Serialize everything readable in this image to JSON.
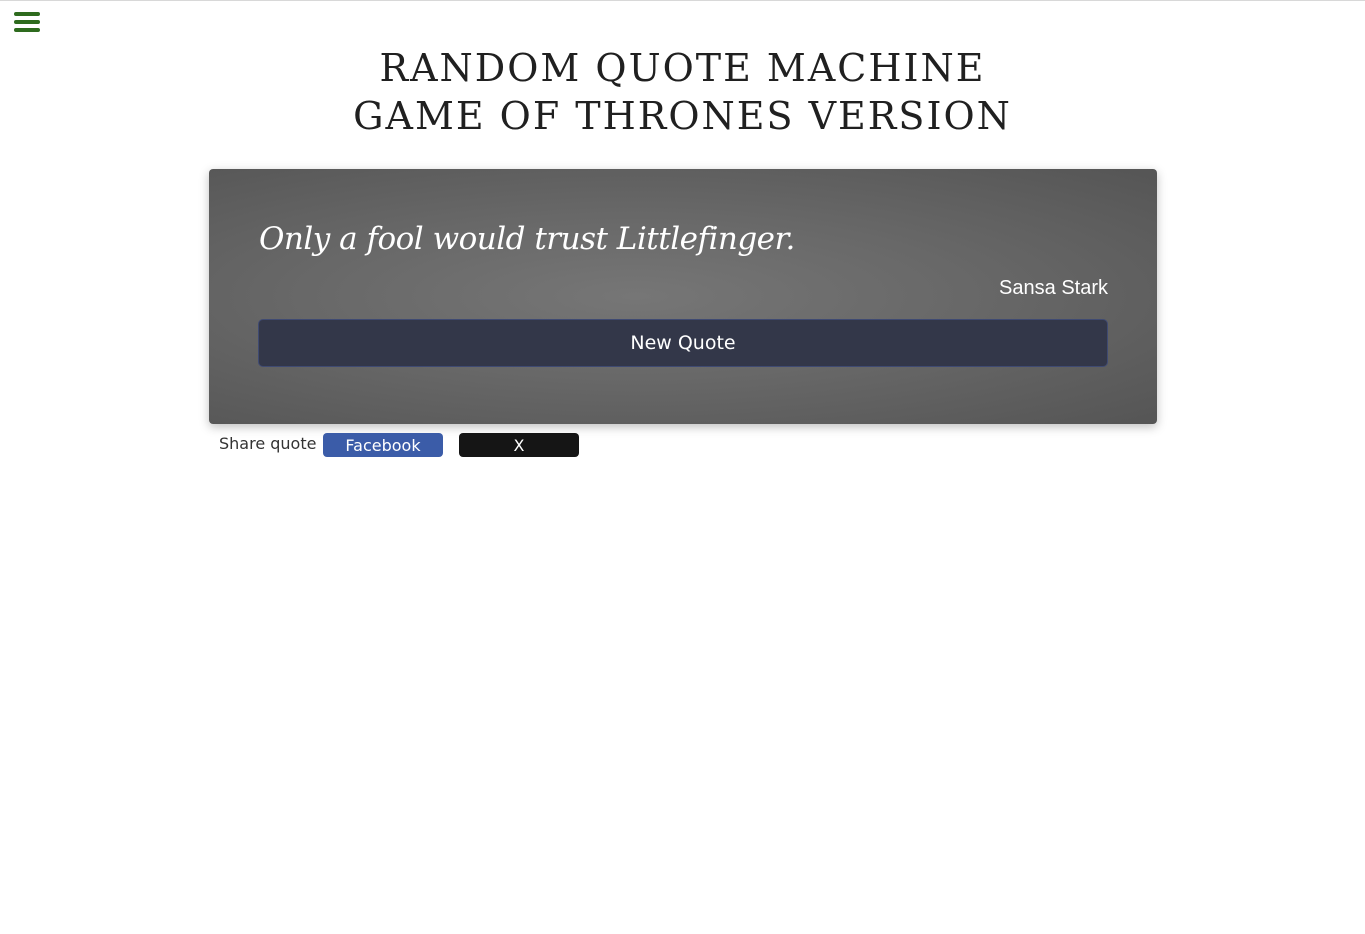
{
  "header": {
    "menu_icon": "hamburger-menu-icon",
    "menu_color": "#2e6b1e",
    "title_line1": "RANDOM QUOTE MACHINE",
    "title_line2": "GAME OF THRONES VERSION"
  },
  "quote": {
    "text": "Only a fool would trust Littlefinger.",
    "author": "Sansa Stark",
    "new_quote_label": "New Quote",
    "button_color": "#333749"
  },
  "share": {
    "label": "Share quote",
    "facebook_label": "Facebook",
    "facebook_color": "#3b5ca8",
    "x_label": "X",
    "x_color": "#151515"
  }
}
